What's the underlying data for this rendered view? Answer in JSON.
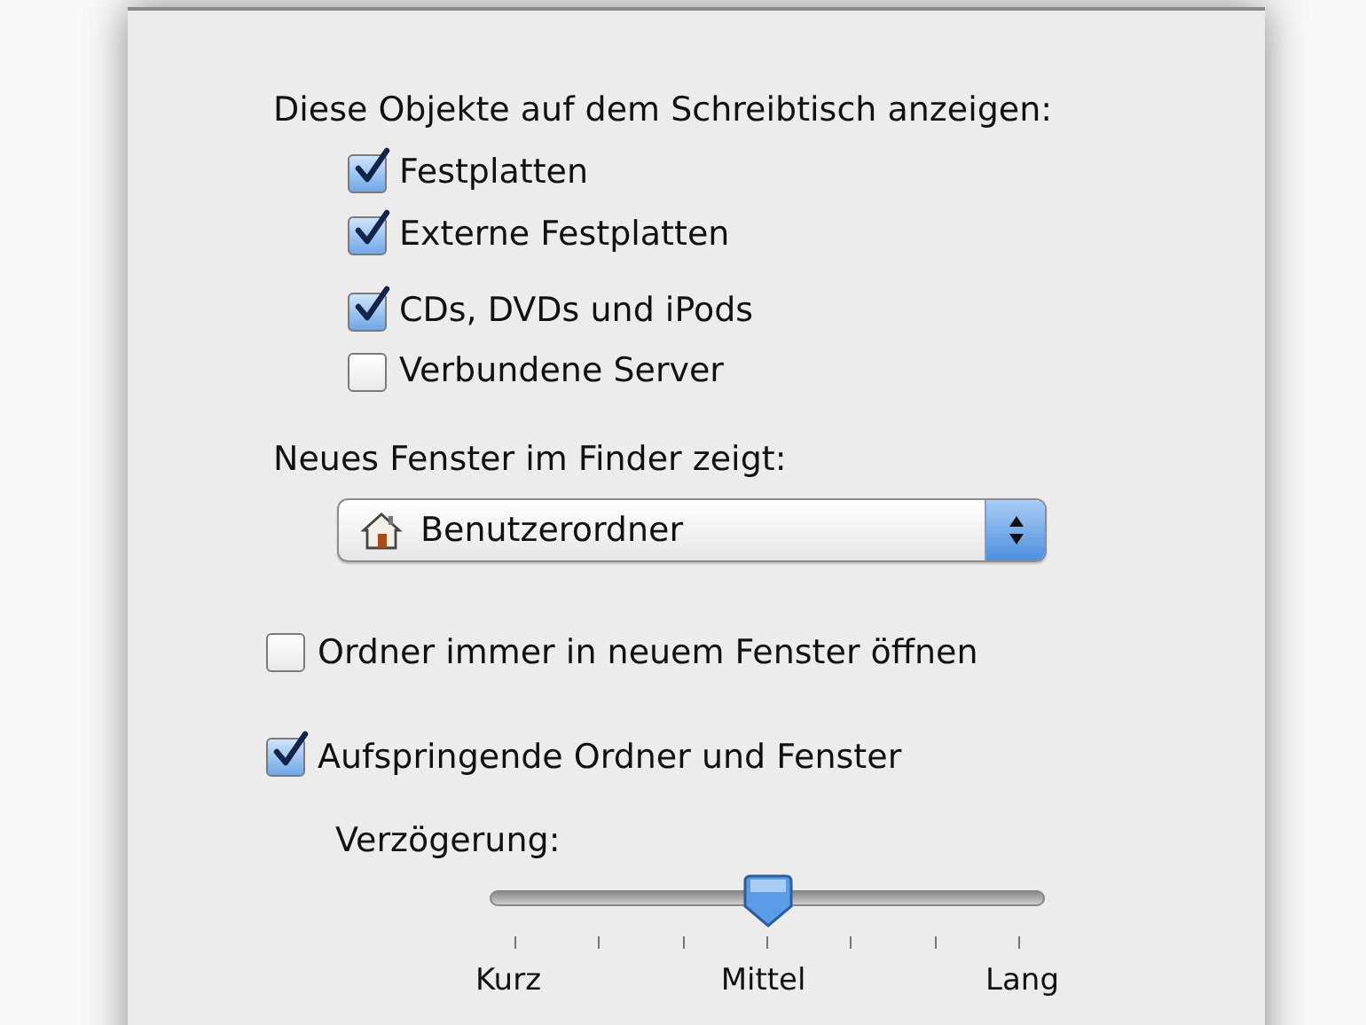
{
  "desktop_section": {
    "title": "Diese Objekte auf dem Schreibtisch anzeigen:",
    "items": [
      {
        "label": "Festplatten",
        "checked": true
      },
      {
        "label": "Externe Festplatten",
        "checked": true
      },
      {
        "label": "CDs, DVDs und iPods",
        "checked": true
      },
      {
        "label": "Verbundene Server",
        "checked": false
      }
    ]
  },
  "new_window": {
    "label": "Neues Fenster im Finder zeigt:",
    "value": "Benutzerordner"
  },
  "open_in_new_window": {
    "label": "Ordner immer in neuem Fenster öffnen",
    "checked": false
  },
  "spring_loaded": {
    "label": "Aufspringende Ordner und Fenster",
    "checked": true
  },
  "delay": {
    "label": "Verzögerung:",
    "level": 0.5,
    "tick_labels": [
      "Kurz",
      "Mittel",
      "Lang"
    ]
  }
}
